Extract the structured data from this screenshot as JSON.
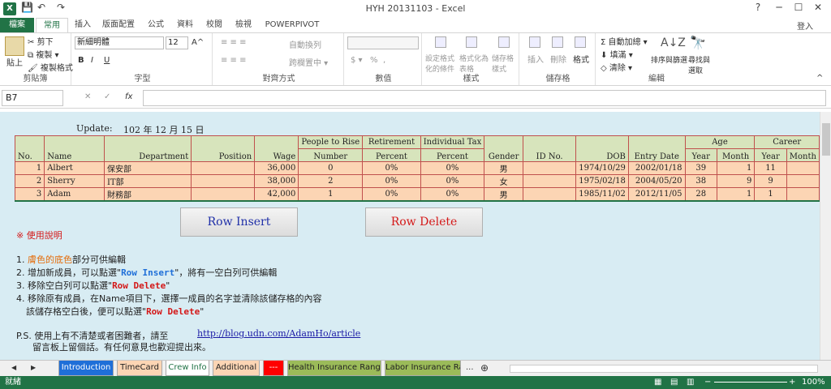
{
  "window": {
    "title": "HYH 20131103 - Excel",
    "help": "?",
    "min": "─",
    "max": "☐",
    "close": "✕",
    "login": "登入"
  },
  "qat": {
    "save": "💾",
    "undo": "↶",
    "redo": "↷"
  },
  "ribbon_tabs": [
    {
      "label": "檔案"
    },
    {
      "label": "常用"
    },
    {
      "label": "插入"
    },
    {
      "label": "版面配置"
    },
    {
      "label": "公式"
    },
    {
      "label": "資料"
    },
    {
      "label": "校閱"
    },
    {
      "label": "檢視"
    },
    {
      "label": "POWERPIVOT"
    }
  ],
  "ribbon": {
    "clipboard": {
      "label": "剪貼簿",
      "paste": "貼上",
      "cut": "剪下",
      "copy": "複製 ▾",
      "format_painter": "複製格式"
    },
    "font": {
      "label": "字型",
      "name": "新細明體",
      "size": "12",
      "bold": "B",
      "italic": "I",
      "underline": "U",
      "grow": "A^",
      "shrink": "A˅"
    },
    "alignment": {
      "label": "對齊方式",
      "wrap": "自動換列",
      "merge": "跨欄置中 ▾"
    },
    "number": {
      "label": "數值",
      "currency": "$ ▾",
      "percent": "%",
      "comma": ","
    },
    "styles": {
      "label": "樣式",
      "cond": "設定格式化的條件",
      "table": "格式化為表格",
      "cell": "儲存格樣式"
    },
    "cells": {
      "label": "儲存格",
      "insert": "插入",
      "delete": "刪除",
      "format": "格式"
    },
    "editing": {
      "label": "編輯",
      "autosum": "Σ 自動加總 ▾",
      "fill": "填滿 ▾",
      "clear": "清除 ▾",
      "sort": "排序與篩選",
      "find": "尋找與選取"
    }
  },
  "formula_bar": {
    "name_box": "B7",
    "cancel": "✕",
    "enter": "✓",
    "fx": "fx",
    "value": ""
  },
  "sheet": {
    "update_label": "Update:",
    "update_value": "102 年 12 月 15 日",
    "headers": [
      "No.",
      "Name",
      "Department",
      "Position",
      "Wage",
      "People to Rise",
      "Number",
      "Retirement",
      "Percent",
      "Individual Tax",
      "Percent",
      "Gender",
      "ID No.",
      "DOB",
      "Entry Date",
      "Age",
      "Year",
      "Month",
      "Career",
      "Year",
      "Month"
    ],
    "rows": [
      {
        "no": "1",
        "name": "Albert",
        "dept": "保安部",
        "position": "",
        "wage": "36,000",
        "num": "0",
        "ret": "0%",
        "tax": "0%",
        "gender": "男",
        "id": "",
        "dob": "1974/10/29",
        "entry": "2002/01/18",
        "age_y": "39",
        "age_m": "1",
        "car_y": "11",
        "car_m": ""
      },
      {
        "no": "2",
        "name": "Sherry",
        "dept": "IT部",
        "position": "",
        "wage": "38,000",
        "num": "2",
        "ret": "0%",
        "tax": "0%",
        "gender": "女",
        "id": "",
        "dob": "1975/02/18",
        "entry": "2004/05/20",
        "age_y": "38",
        "age_m": "9",
        "car_y": "9",
        "car_m": ""
      },
      {
        "no": "3",
        "name": "Adam",
        "dept": "財務部",
        "position": "",
        "wage": "42,000",
        "num": "1",
        "ret": "0%",
        "tax": "0%",
        "gender": "男",
        "id": "",
        "dob": "1985/11/02",
        "entry": "2012/11/05",
        "age_y": "28",
        "age_m": "1",
        "car_y": "1",
        "car_m": ""
      }
    ],
    "row_insert": "Row Insert",
    "row_delete": "Row Delete",
    "notes_title": "※  使用說明",
    "note1_a": "1.",
    "note1_b": "膚色的底色",
    "note1_c": "部分可供編輯",
    "note2_a": "2. 增加新成員，可以點選\"",
    "note2_b": "Row Insert",
    "note2_c": "\"，將有一空白列可供編輯",
    "note3_a": "3. 移除空白列可以點選\"",
    "note3_b": "Row Delete",
    "note3_c": "\"",
    "note4": "4. 移除原有成員，在Name項目下，選擇一成員的名字並清除該儲存格的內容",
    "note4b_a": "該儲存格空白後，便可以點選\"",
    "note4b_b": "Row Delete",
    "note4b_c": "\"",
    "ps_a": "P.S. 使用上有不清楚或者困難者，請至",
    "ps_link": "http://blog.udn.com/AdamHo/article",
    "ps_b": "留言板上留個話。有任何意見也歡迎提出來。"
  },
  "sheet_tabs": [
    {
      "label": "Introduction",
      "bg": "#1f6fd8",
      "fg": "#ffffff"
    },
    {
      "label": "TimeCard",
      "bg": "#fcd5b4",
      "fg": "#333333"
    },
    {
      "label": "Crew Info",
      "bg": "#ffffff",
      "fg": "#217346"
    },
    {
      "label": "Additional",
      "bg": "#fcd5b4",
      "fg": "#333333"
    },
    {
      "label": "---",
      "bg": "#ff0000",
      "fg": "#ffffff"
    },
    {
      "label": "Health Insurance Range",
      "bg": "#9bbb59",
      "fg": "#222222"
    },
    {
      "label": "Labor Insurance Ran",
      "bg": "#9bbb59",
      "fg": "#222222"
    }
  ],
  "tab_nav": {
    "prev": "◀",
    "next": "▶",
    "more": "...",
    "add": "⊕"
  },
  "status": {
    "ready": "就緒",
    "zoom": "100%",
    "zoom_minus": "−",
    "zoom_plus": "+"
  }
}
